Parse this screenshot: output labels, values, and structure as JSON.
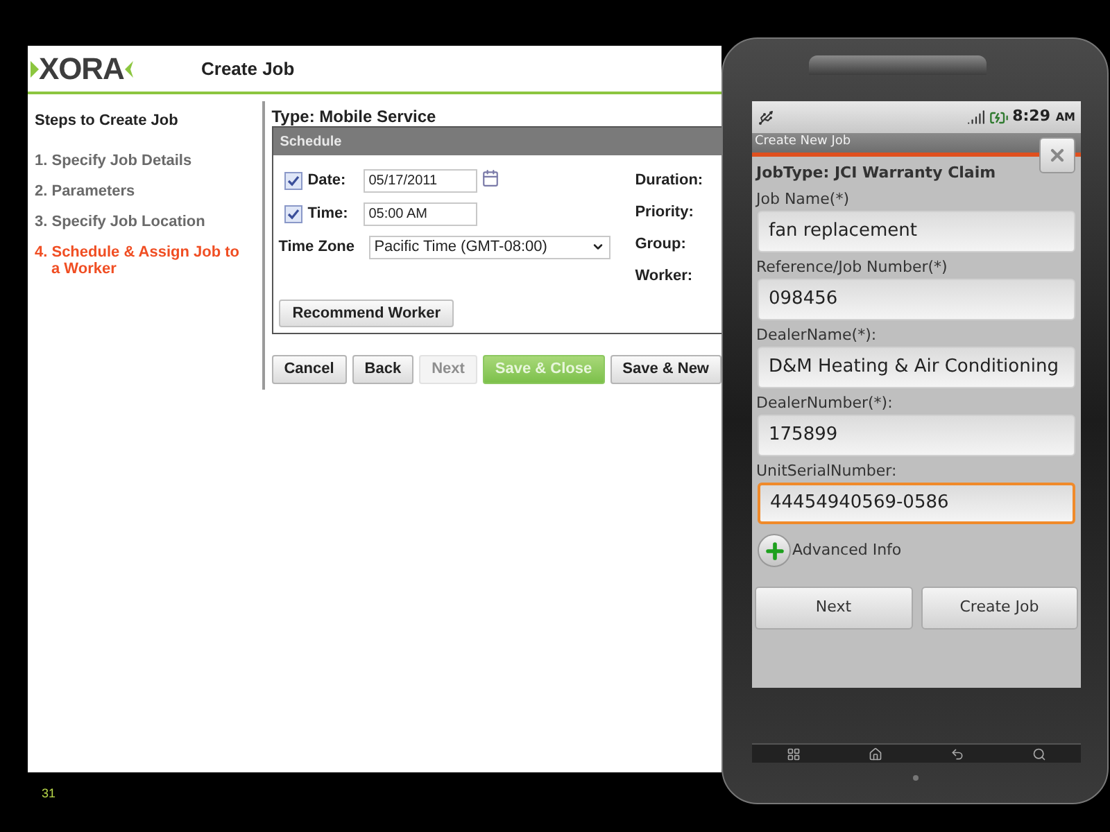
{
  "app": {
    "logo": "XORA",
    "title": "Create Job"
  },
  "steps": {
    "heading": "Steps to Create Job",
    "items": [
      {
        "label": "1. Specify Job Details",
        "selected": false
      },
      {
        "label": "2. Parameters",
        "selected": false
      },
      {
        "label": "3. Specify Job Location",
        "selected": false
      },
      {
        "label": "4. Schedule & Assign Job to a Worker",
        "selected": true
      }
    ]
  },
  "form": {
    "type_label": "Type: Mobile Service",
    "section": "Schedule",
    "date": {
      "label": "Date:",
      "value": "05/17/2011",
      "checked": true
    },
    "time": {
      "label": "Time:",
      "value": "05:00 AM",
      "checked": true
    },
    "time_zone": {
      "label": "Time Zone",
      "value": "Pacific Time (GMT-08:00)"
    },
    "right_labels": [
      "Duration:",
      "Priority:",
      "Group:",
      "Worker:"
    ],
    "recommend_button": "Recommend Worker"
  },
  "buttons": [
    {
      "label": "Cancel",
      "kind": "normal"
    },
    {
      "label": "Back",
      "kind": "normal"
    },
    {
      "label": "Next",
      "kind": "disabled"
    },
    {
      "label": "Save & Close",
      "kind": "primary"
    },
    {
      "label": "Save & New",
      "kind": "normal"
    }
  ],
  "phone": {
    "status_time": "8:29",
    "status_ampm": "AM",
    "screen_title": "Create New Job",
    "job_type": "JobType: JCI Warranty Claim",
    "fields": [
      {
        "label": "Job Name(*)",
        "value": "fan replacement",
        "focused": false
      },
      {
        "label": "Reference/Job Number(*)",
        "value": "098456",
        "focused": false
      },
      {
        "label": "DealerName(*):",
        "value": "D&M Heating & Air Conditioning",
        "focused": false
      },
      {
        "label": "DealerNumber(*):",
        "value": "175899",
        "focused": false
      },
      {
        "label": "UnitSerialNumber:",
        "value": "44454940569-0586",
        "focused": true
      }
    ],
    "advanced": "Advanced Info",
    "buttons": [
      "Next",
      "Create Job"
    ]
  },
  "slide_number": "31"
}
